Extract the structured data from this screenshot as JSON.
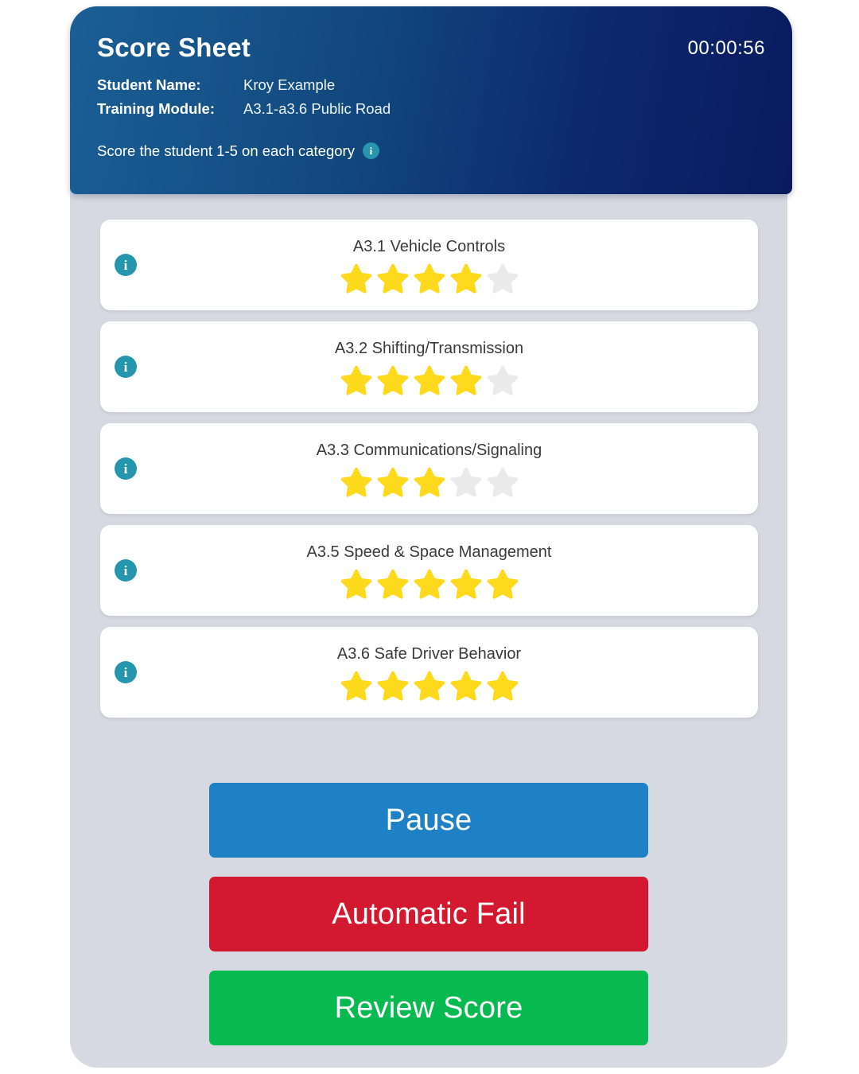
{
  "header": {
    "title": "Score Sheet",
    "timer": "00:00:56",
    "student_name_label": "Student Name:",
    "student_name_value": "Kroy Example",
    "training_module_label": "Training Module:",
    "training_module_value": "A3.1-a3.6 Public Road",
    "instruction": "Score the student 1-5 on each category",
    "instruction_icon": "info-icon",
    "gradient_from": "#1a5f96",
    "gradient_to": "#0a1a5e"
  },
  "colors": {
    "body_background": "#d6d9e2",
    "card_background": "#ffffff",
    "info_icon": "#2596ae",
    "star_filled": "#ffd91c",
    "star_empty": "#eaeaea",
    "pause": "#1e81c6",
    "fail": "#d2192f",
    "review": "#07ba50"
  },
  "rating": {
    "max_stars": 5,
    "categories": [
      {
        "label": "A3.1 Vehicle Controls",
        "score": 4,
        "info_icon": "info-icon"
      },
      {
        "label": "A3.2 Shifting/Transmission",
        "score": 4,
        "info_icon": "info-icon"
      },
      {
        "label": "A3.3 Communications/Signaling",
        "score": 3,
        "info_icon": "info-icon"
      },
      {
        "label": "A3.5 Speed & Space Management",
        "score": 5,
        "info_icon": "info-icon"
      },
      {
        "label": "A3.6 Safe Driver Behavior",
        "score": 5,
        "info_icon": "info-icon"
      }
    ]
  },
  "actions": {
    "pause_label": "Pause",
    "fail_label": "Automatic Fail",
    "review_label": "Review Score"
  }
}
